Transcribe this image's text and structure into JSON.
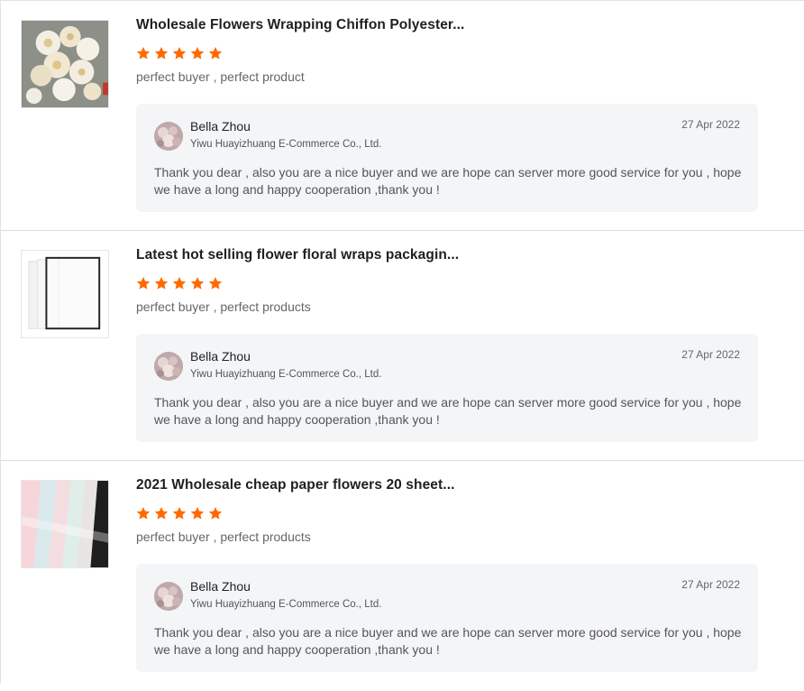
{
  "reviews": [
    {
      "product_title": "Wholesale Flowers Wrapping Chiffon Polyester...",
      "rating": 5,
      "comment": "perfect buyer , perfect product",
      "thumbnail": "flower-bouquet-image",
      "reply": {
        "name": "Bella Zhou",
        "company": "Yiwu Huayizhuang E-Commerce Co., Ltd.",
        "date": "27 Apr 2022",
        "text": "Thank you dear , also you are a nice buyer  and we are hope can server more good service for you , hope we have a long and happy cooperation ,thank you !"
      }
    },
    {
      "product_title": "Latest hot selling flower floral wraps packagin...",
      "rating": 5,
      "comment": "perfect buyer , perfect products",
      "thumbnail": "white-wrapping-paper-image",
      "reply": {
        "name": "Bella Zhou",
        "company": "Yiwu Huayizhuang E-Commerce Co., Ltd.",
        "date": "27 Apr 2022",
        "text": "Thank you dear , also you are a nice buyer  and we are hope can server more good service for you , hope we have a long and happy cooperation ,thank you !"
      }
    },
    {
      "product_title": "2021 Wholesale cheap paper flowers 20 sheet...",
      "rating": 5,
      "comment": "perfect buyer , perfect products",
      "thumbnail": "pastel-paper-sheets-image",
      "reply": {
        "name": "Bella Zhou",
        "company": "Yiwu Huayizhuang E-Commerce Co., Ltd.",
        "date": "27 Apr 2022",
        "text": "Thank you dear , also you are a nice buyer  and we are hope can server more good service for you , hope we have a long and happy cooperation ,thank you !"
      }
    }
  ],
  "colors": {
    "star": "#ff6a00",
    "reply_bg": "#f4f5f7",
    "divider": "#dcdcdc"
  },
  "icons": {
    "star": "star-icon"
  }
}
